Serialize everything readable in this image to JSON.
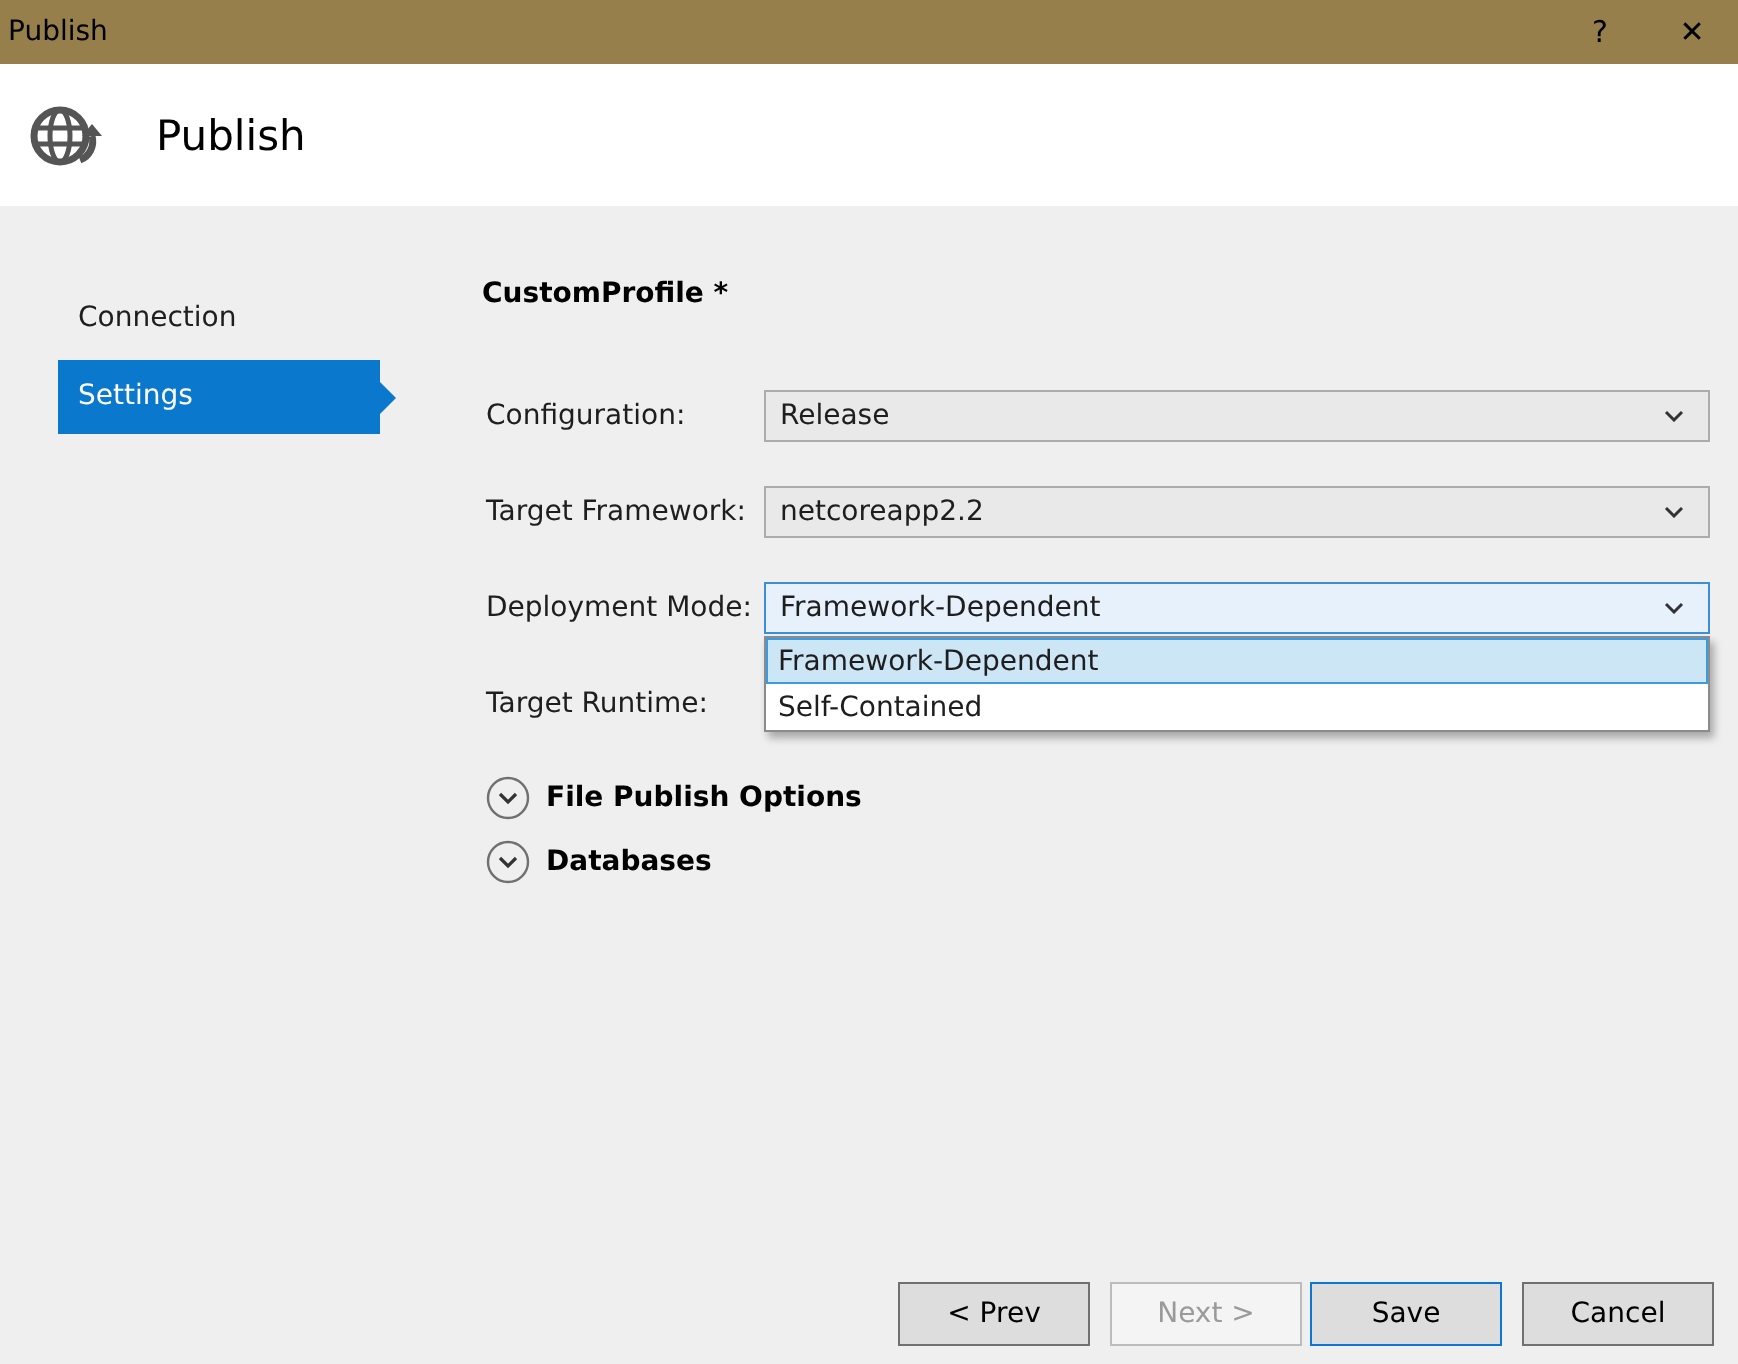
{
  "window": {
    "title": "Publish",
    "help": "?",
    "close": "✕"
  },
  "header": {
    "title": "Publish"
  },
  "sidebar": {
    "items": [
      {
        "label": "Connection",
        "selected": false
      },
      {
        "label": "Settings",
        "selected": true
      }
    ]
  },
  "profile": {
    "title": "CustomProfile *"
  },
  "fields": [
    {
      "label": "Configuration:",
      "value": "Release",
      "focused": false
    },
    {
      "label": "Target Framework:",
      "value": "netcoreapp2.2",
      "focused": false
    },
    {
      "label": "Deployment Mode:",
      "value": "Framework-Dependent",
      "focused": true,
      "options": [
        {
          "label": "Framework-Dependent",
          "selected": true
        },
        {
          "label": "Self-Contained",
          "selected": false
        }
      ]
    },
    {
      "label": "Target Runtime:"
    }
  ],
  "sections": [
    {
      "label": "File Publish Options",
      "expanded": false
    },
    {
      "label": "Databases",
      "expanded": false
    }
  ],
  "buttons": [
    {
      "label": "< Prev",
      "disabled": false,
      "default": false
    },
    {
      "label": "Next >",
      "disabled": true,
      "default": false
    },
    {
      "label": "Save",
      "disabled": false,
      "default": true
    },
    {
      "label": "Cancel",
      "disabled": false,
      "default": false
    }
  ]
}
